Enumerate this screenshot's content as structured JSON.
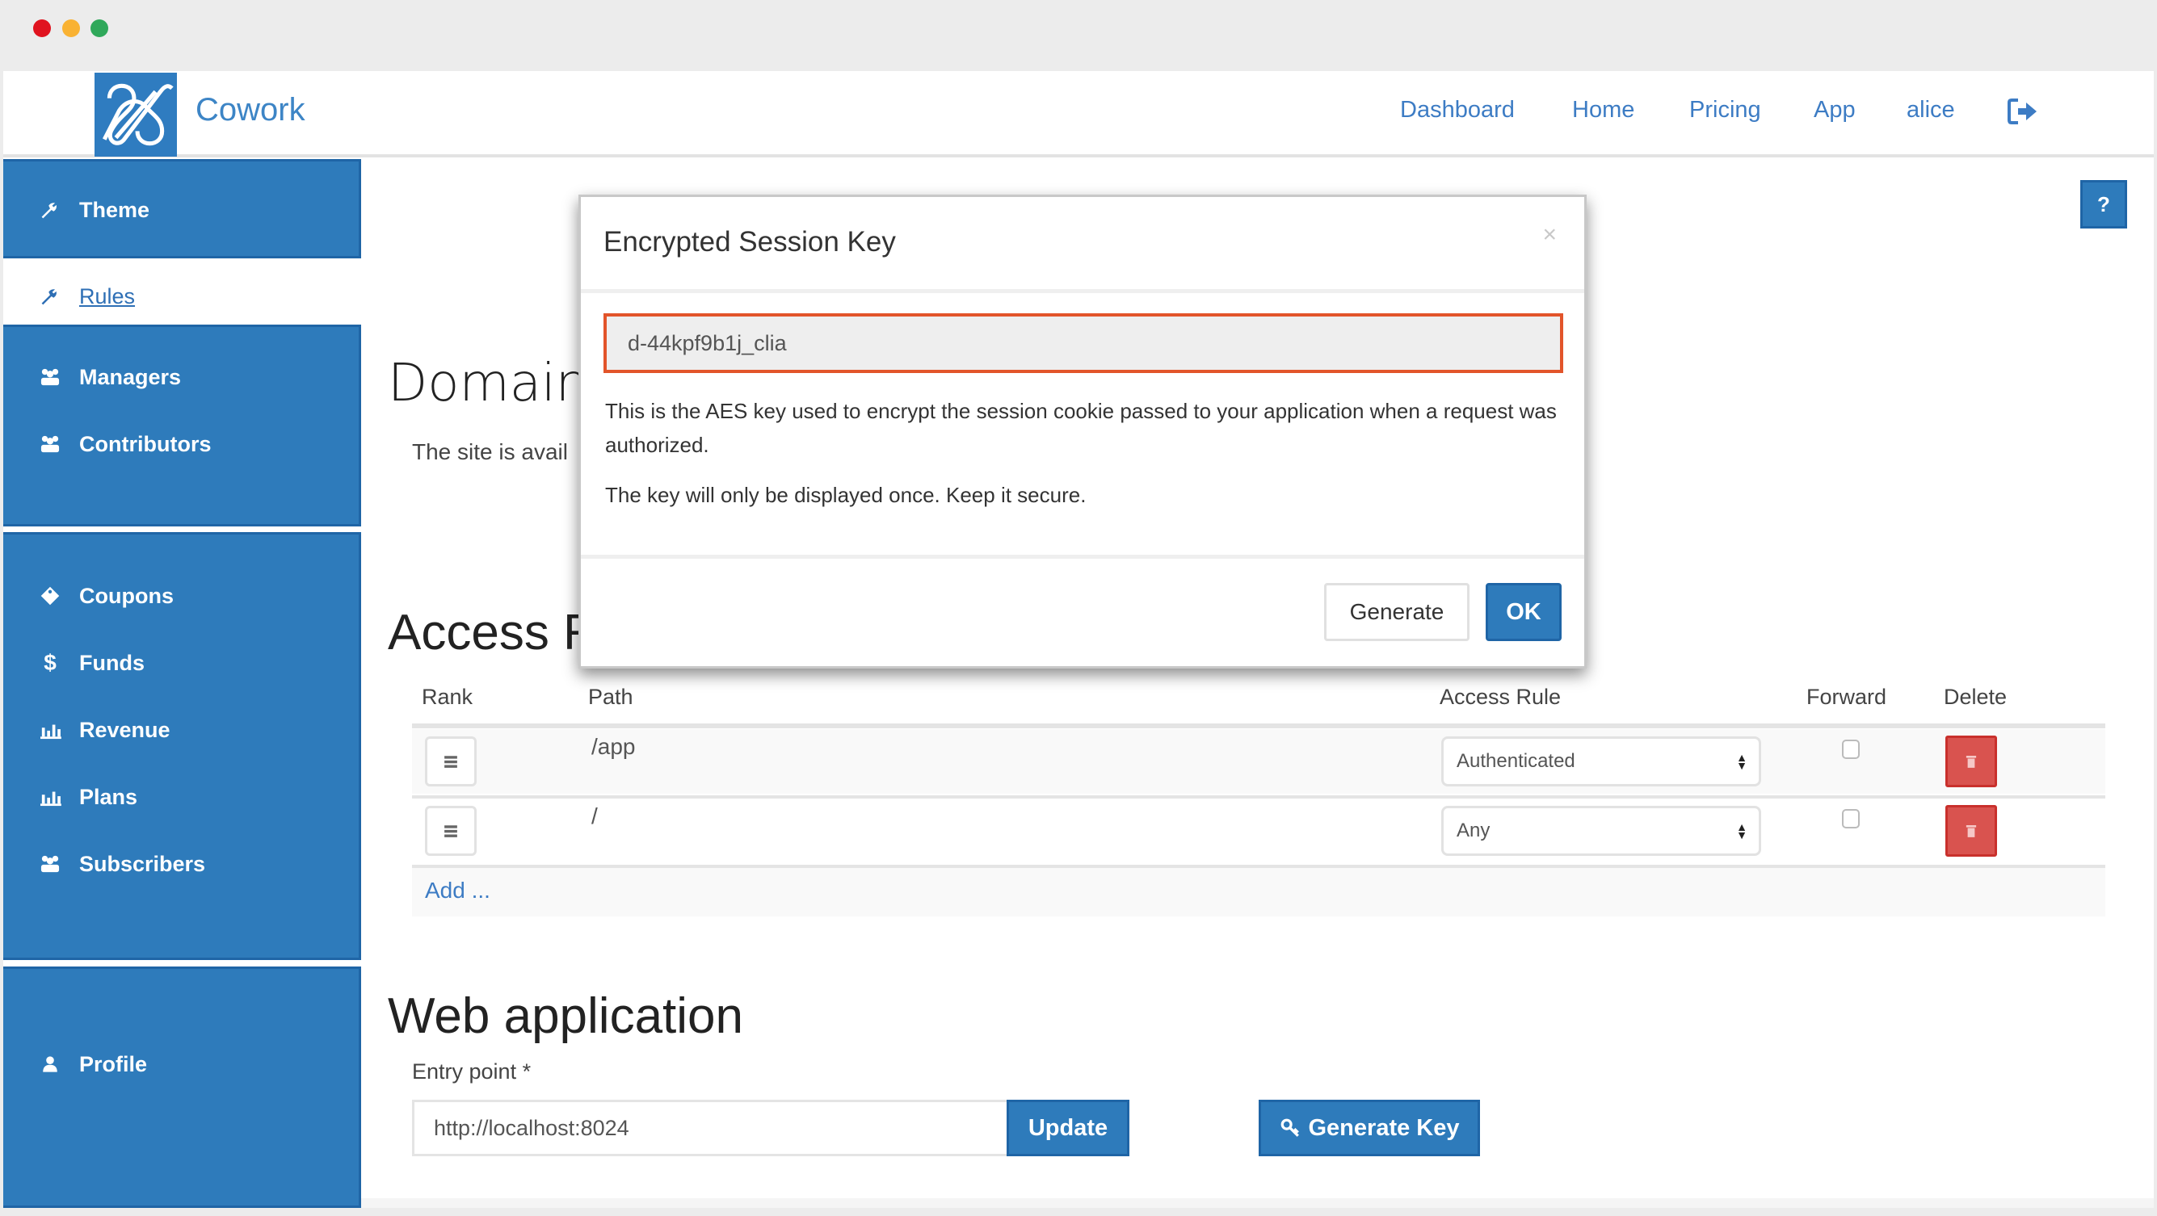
{
  "window": {
    "traffic_lights": [
      "close",
      "minimize",
      "maximize"
    ]
  },
  "header": {
    "brand": "Cowork",
    "logo_icon": "cowork-logo-icon",
    "nav": [
      {
        "label": "Dashboard"
      },
      {
        "label": "Home"
      },
      {
        "label": "Pricing"
      },
      {
        "label": "App"
      },
      {
        "label": "alice"
      }
    ],
    "logout_icon": "sign-out-icon"
  },
  "sidebar": {
    "groups": [
      {
        "items": [
          {
            "label": "Theme",
            "icon": "wrench-icon"
          }
        ]
      },
      {
        "items": [
          {
            "label": "Rules",
            "icon": "wrench-icon",
            "active": true
          }
        ]
      },
      {
        "items": [
          {
            "label": "Managers",
            "icon": "users-icon"
          },
          {
            "label": "Contributors",
            "icon": "users-icon"
          }
        ]
      },
      {
        "items": [
          {
            "label": "Coupons",
            "icon": "tag-icon"
          },
          {
            "label": "Funds",
            "icon": "dollar-icon"
          },
          {
            "label": "Revenue",
            "icon": "bar-chart-icon"
          },
          {
            "label": "Plans",
            "icon": "bar-chart-icon"
          },
          {
            "label": "Subscribers",
            "icon": "users-icon"
          }
        ]
      },
      {
        "items": [
          {
            "label": "Profile",
            "icon": "user-icon"
          }
        ]
      }
    ]
  },
  "main": {
    "help_button": "?",
    "domain": {
      "heading": "Domain",
      "subtitle": "The site is avail"
    },
    "access_rules": {
      "heading": "Access Rules",
      "columns": [
        "Rank",
        "Path",
        "Access Rule",
        "Forward",
        "Delete"
      ],
      "rows": [
        {
          "path": "/app",
          "access_rule": "Authenticated",
          "forward": false
        },
        {
          "path": "/",
          "access_rule": "Any",
          "forward": false
        }
      ],
      "add_link": "Add ..."
    },
    "web_application": {
      "heading": "Web application",
      "entry_point_label": "Entry point *",
      "entry_point_value": "http://localhost:8024",
      "update_button": "Update",
      "generate_key_button": "Generate Key",
      "generate_key_icon": "key-icon"
    }
  },
  "modal": {
    "title": "Encrypted Session Key",
    "close": "×",
    "key_value": "d-44kpf9b1j_clia",
    "description": "This is the AES key used to encrypt the session cookie passed to your application when a request was authorized.",
    "warning": "The key will only be displayed once. Keep it secure.",
    "generate_button": "Generate",
    "ok_button": "OK",
    "key_border_color": "#e2542a"
  },
  "colors": {
    "brand_blue": "#2e7bbb",
    "link_blue": "#3d7cc4",
    "danger_red": "#d9534f"
  }
}
